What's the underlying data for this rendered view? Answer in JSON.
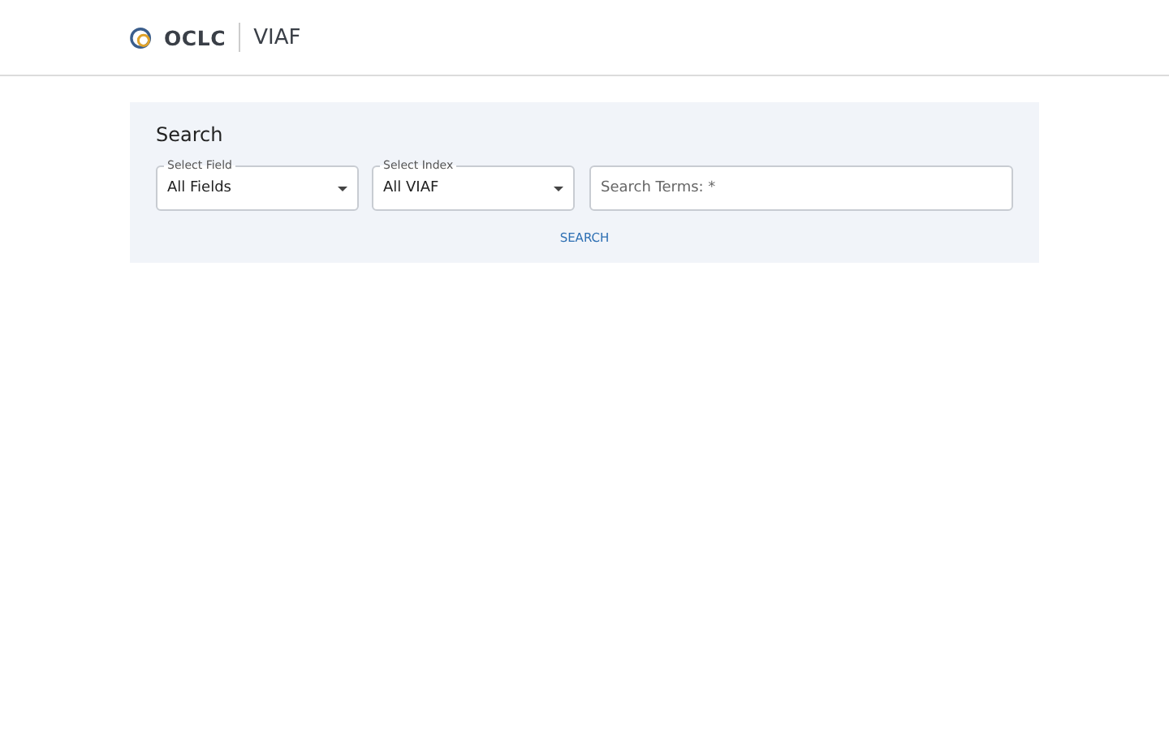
{
  "header": {
    "logo_text": "OCLC",
    "product": "VIAF"
  },
  "search_panel": {
    "title": "Search",
    "selects": [
      {
        "label": "Select Field",
        "value": "All Fields"
      },
      {
        "label": "Select Index",
        "value": "All VIAF"
      }
    ],
    "terms_field": {
      "placeholder": "Search Terms: *"
    },
    "button": "SEARCH"
  }
}
